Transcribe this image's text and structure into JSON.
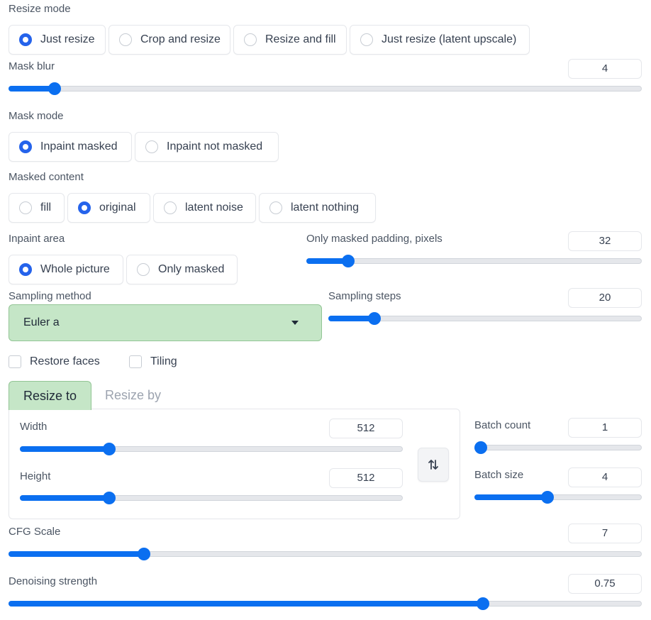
{
  "resize_mode": {
    "label": "Resize mode",
    "options": [
      "Just resize",
      "Crop and resize",
      "Resize and fill",
      "Just resize (latent upscale)"
    ],
    "selected": "Just resize"
  },
  "mask_blur": {
    "label": "Mask blur",
    "value": "4",
    "fraction": 0.073
  },
  "mask_mode": {
    "label": "Mask mode",
    "options": [
      "Inpaint masked",
      "Inpaint not masked"
    ],
    "selected": "Inpaint masked"
  },
  "masked_content": {
    "label": "Masked content",
    "options": [
      "fill",
      "original",
      "latent noise",
      "latent nothing"
    ],
    "selected": "original"
  },
  "inpaint_area": {
    "label": "Inpaint area",
    "options": [
      "Whole picture",
      "Only masked"
    ],
    "selected": "Whole picture"
  },
  "only_masked_padding": {
    "label": "Only masked padding, pixels",
    "value": "32",
    "fraction": 0.125
  },
  "sampling_method": {
    "label": "Sampling method",
    "value": "Euler a",
    "accent": "#c5e6c7"
  },
  "sampling_steps": {
    "label": "Sampling steps",
    "value": "20",
    "fraction": 0.146
  },
  "checkboxes": {
    "restore_faces": {
      "label": "Restore faces",
      "checked": false
    },
    "tiling": {
      "label": "Tiling",
      "checked": false
    }
  },
  "tabs": {
    "resize_to": "Resize to",
    "resize_by": "Resize by",
    "active": "Resize to"
  },
  "width": {
    "label": "Width",
    "value": "512",
    "fraction": 0.234
  },
  "height": {
    "label": "Height",
    "value": "512",
    "fraction": 0.234
  },
  "swap_icon": "swap-vertical-icon",
  "batch_count": {
    "label": "Batch count",
    "value": "1",
    "fraction": 0.0
  },
  "batch_size": {
    "label": "Batch size",
    "value": "4",
    "fraction": 0.435
  },
  "cfg_scale": {
    "label": "CFG Scale",
    "value": "7",
    "fraction": 0.214
  },
  "denoising_strength": {
    "label": "Denoising strength",
    "value": "0.75",
    "fraction": 0.749
  },
  "colors": {
    "accent_blue": "#0b6ff0",
    "radio_blue": "#2563eb",
    "tab_green": "#c5e6c7"
  }
}
